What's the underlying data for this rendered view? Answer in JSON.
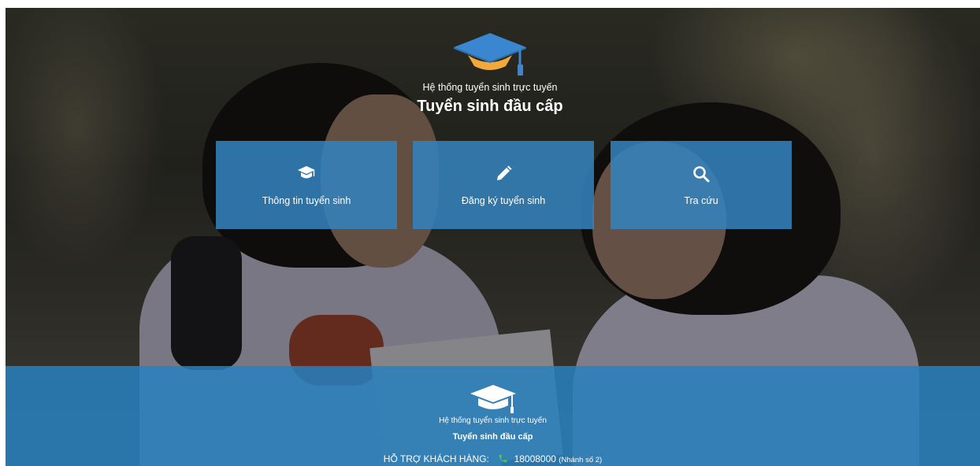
{
  "header": {
    "subtitle": "Hệ thống tuyển sinh trực tuyến",
    "title": "Tuyển sinh đầu cấp",
    "logo_icon": "graduation-cap-icon"
  },
  "tiles": [
    {
      "label": "Thông tin tuyển sinh",
      "icon": "graduation-cap-icon"
    },
    {
      "label": "Đăng ký tuyển sinh",
      "icon": "pencil-icon"
    },
    {
      "label": "Tra cứu",
      "icon": "search-icon"
    }
  ],
  "footer": {
    "subtitle": "Hệ thống tuyển sinh trực tuyến",
    "title": "Tuyển sinh đầu cấp",
    "support_label": "HỖ TRỢ KHÁCH HÀNG:",
    "phone": "18008000",
    "branch": "(Nhánh số 2)",
    "phone_icon": "phone-icon"
  },
  "colors": {
    "tile_blue": "#3482bc",
    "footer_blue": "#2880be",
    "logo_blue": "#3b86d1",
    "logo_orange": "#f2a93b",
    "phone_green": "#4cc65a"
  }
}
